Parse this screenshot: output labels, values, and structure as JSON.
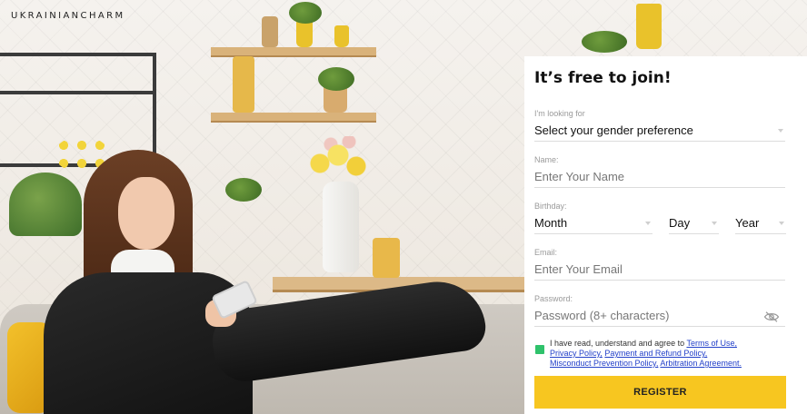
{
  "brand": {
    "logo": "UKRAINIANCHARM"
  },
  "form": {
    "title": "It’s free to join!",
    "looking_for": {
      "label": "I'm looking for",
      "value": "Select your gender preference"
    },
    "name": {
      "label": "Name:",
      "placeholder": "Enter Your Name"
    },
    "birthday": {
      "label": "Birthday:",
      "month": "Month",
      "day": "Day",
      "year": "Year"
    },
    "email": {
      "label": "Email:",
      "placeholder": "Enter Your Email"
    },
    "password": {
      "label": "Password:",
      "placeholder": "Password (8+ characters)"
    },
    "terms": {
      "prefix": "I have read, understand and agree to ",
      "links": [
        "Terms of Use,",
        "Privacy Policy,",
        "Payment and Refund Policy,",
        "Misconduct Prevention Policy,",
        "Arbitration Agreement."
      ],
      "checked": true
    },
    "register_label": "REGISTER"
  },
  "colors": {
    "accent": "#f7c620",
    "checkbox": "#2fc26b",
    "link": "#2340c9"
  },
  "icons": {
    "password_toggle": "eye-slash-icon",
    "select_caret": "chevron-down-icon"
  }
}
